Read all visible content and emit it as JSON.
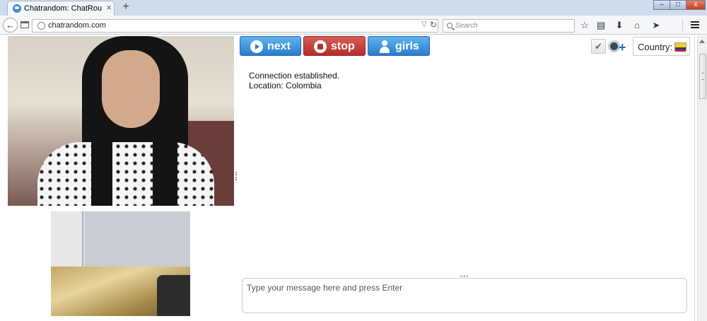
{
  "browser": {
    "tab_title": "Chatrandom: ChatRoulette...",
    "tab_close": "×",
    "new_tab": "+",
    "window_min": "–",
    "window_max": "□",
    "window_close": "x",
    "back": "←",
    "url": "chatrandom.com",
    "url_dropdown": "▽",
    "url_reload": "↻",
    "search_placeholder": "Search",
    "toolbar_icons": [
      "star-icon",
      "clipboard-icon",
      "download-icon",
      "home-icon",
      "send-icon",
      "menu-icon"
    ],
    "bookmark_glyph": "☆",
    "reading_list_glyph": "▤",
    "download_glyph": "⬇",
    "home_glyph": "⌂",
    "send_glyph": "➤"
  },
  "controls": {
    "next_label": "next",
    "stop_label": "stop",
    "girls_label": "girls",
    "check_glyph": "✔",
    "cam_plus": "+",
    "country_label": "Country:",
    "country_flag": "Colombia flag"
  },
  "chat": {
    "line1": "Connection established.",
    "line2": "Location: Colombia",
    "input_placeholder": "Type your message here and press Enter",
    "handle_dots": "•••"
  },
  "colors": {
    "next_button": "#2a7ccd",
    "stop_button": "#b22e2b",
    "girls_button": "#2a7ccd",
    "flag_yellow": "#f3d11b",
    "flag_blue": "#1b3aa0",
    "flag_red": "#d21c26"
  }
}
